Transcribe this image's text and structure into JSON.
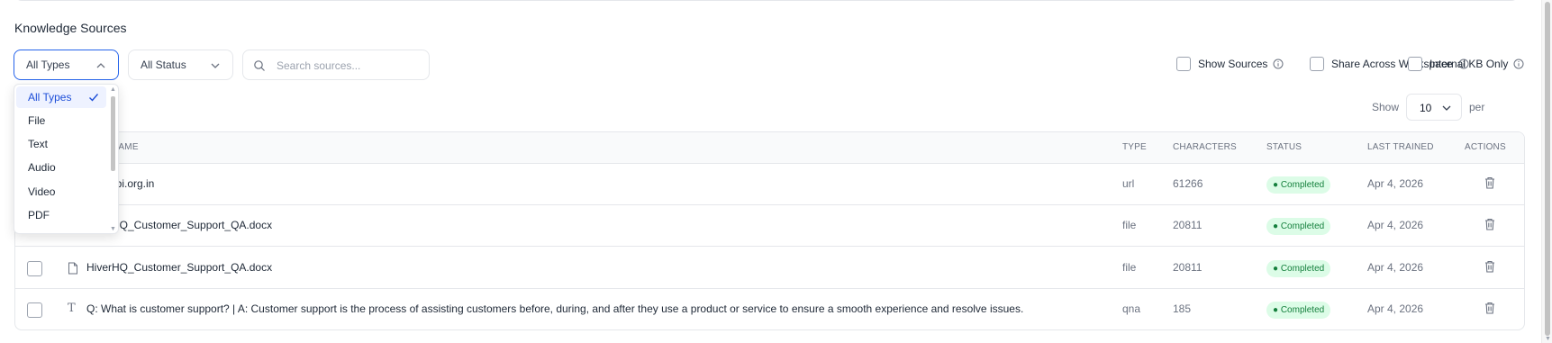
{
  "page": {
    "title": "Knowledge Sources"
  },
  "filters": {
    "types_label": "All Types",
    "status_label": "All Status",
    "search_placeholder": "Search sources..."
  },
  "type_options": [
    {
      "label": "All Types",
      "selected": true
    },
    {
      "label": "File",
      "selected": false
    },
    {
      "label": "Text",
      "selected": false
    },
    {
      "label": "Audio",
      "selected": false
    },
    {
      "label": "Video",
      "selected": false
    },
    {
      "label": "PDF",
      "selected": false
    }
  ],
  "toggles": {
    "show_sources": "Show Sources",
    "share_workspace": "Share Across Workspace",
    "internal_kb": "Internal KB Only"
  },
  "pagination": {
    "show_label": "Show",
    "page_size": "10",
    "per_page_label": "per page"
  },
  "table": {
    "headers": {
      "name": "NAME",
      "type": "TYPE",
      "characters": "CHARACTERS",
      "status": "STATUS",
      "last_trained": "LAST TRAINED",
      "actions": "ACTIONS"
    },
    "rows": [
      {
        "icon": "globe-icon",
        "name": "www.rbi.org.in",
        "type": "url",
        "characters": "61266",
        "status": "Completed",
        "last_trained": "Apr 4, 2026"
      },
      {
        "icon": "file-icon",
        "name": "HiverHQ_Customer_Support_QA.docx",
        "type": "file",
        "characters": "20811",
        "status": "Completed",
        "last_trained": "Apr 4, 2026"
      },
      {
        "icon": "file-icon",
        "name": "HiverHQ_Customer_Support_QA.docx",
        "type": "file",
        "characters": "20811",
        "status": "Completed",
        "last_trained": "Apr 4, 2026"
      },
      {
        "icon": "text-icon",
        "name": "Q: What is customer support? | A: Customer support is the process of assisting customers before, during, and after they use a product or service to ensure a smooth experience and resolve issues.",
        "type": "qna",
        "characters": "185",
        "status": "Completed",
        "last_trained": "Apr 4, 2026"
      }
    ]
  },
  "colors": {
    "accent": "#2563eb",
    "status_bg": "#dcfce7",
    "status_text": "#15803d",
    "border": "#e5e7eb"
  }
}
